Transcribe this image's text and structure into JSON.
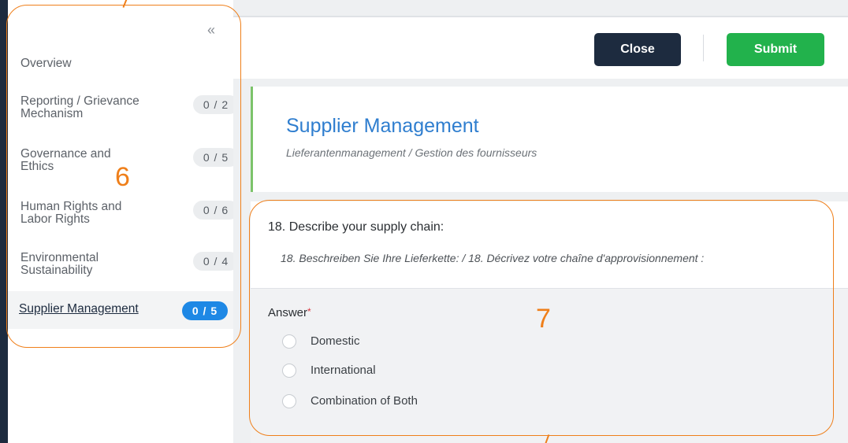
{
  "sidebar": {
    "collapse_glyph": "«",
    "items": [
      {
        "label": "Overview",
        "badge": ""
      },
      {
        "label": "Reporting / Grievance Mechanism",
        "badge": "0 / 2"
      },
      {
        "label": "Governance and Ethics",
        "badge": "0 / 5"
      },
      {
        "label": "Human Rights and Labor Rights",
        "badge": "0 / 6"
      },
      {
        "label": "Environmental Sustainability",
        "badge": "0 / 4"
      }
    ],
    "active": {
      "label": "Supplier Management",
      "badge": "0 / 5"
    }
  },
  "toolbar": {
    "close_label": "Close",
    "submit_label": "Submit"
  },
  "section": {
    "title": "Supplier Management",
    "subtitle": "Lieferantenmanagement / Gestion des fournisseurs"
  },
  "question": {
    "title": "18. Describe your supply chain:",
    "subtitle": "18. Beschreiben Sie Ihre Lieferkette: / 18. Décrivez votre chaîne d'approvisionnement :",
    "answer_label": "Answer",
    "required_mark": "*",
    "options": [
      "Domestic",
      "International",
      "Combination of Both"
    ]
  },
  "annotations": {
    "sidebar_number": "6",
    "question_number": "7"
  },
  "colors": {
    "background": "#1d2b3f",
    "accent_blue": "#1e88e5",
    "submit_green": "#22b24c",
    "annotation_orange": "#ef7f1a",
    "section_border": "#7cc36a"
  }
}
